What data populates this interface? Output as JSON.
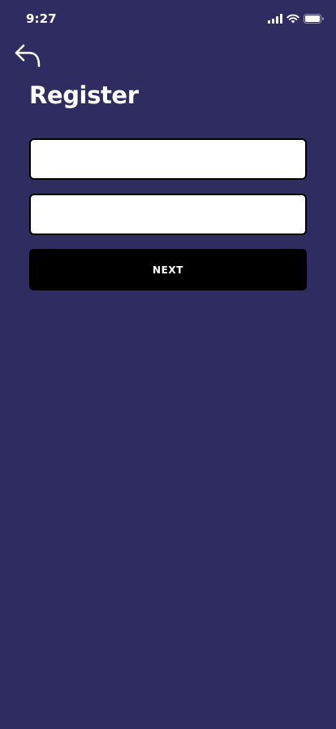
{
  "status_bar": {
    "time": "9:27",
    "icons": [
      "signal-icon",
      "wifi-icon",
      "battery-icon"
    ]
  },
  "header": {
    "back_icon": "back-arrow-icon",
    "title": "Register"
  },
  "form": {
    "field_1": {
      "value": "",
      "placeholder": ""
    },
    "field_2": {
      "value": "",
      "placeholder": ""
    },
    "next_label": "NEXT"
  },
  "colors": {
    "background": "#2f2c62",
    "field_background": "#ffffff",
    "field_border": "#000000",
    "button_background": "#000000",
    "text_primary": "#ffffff"
  }
}
